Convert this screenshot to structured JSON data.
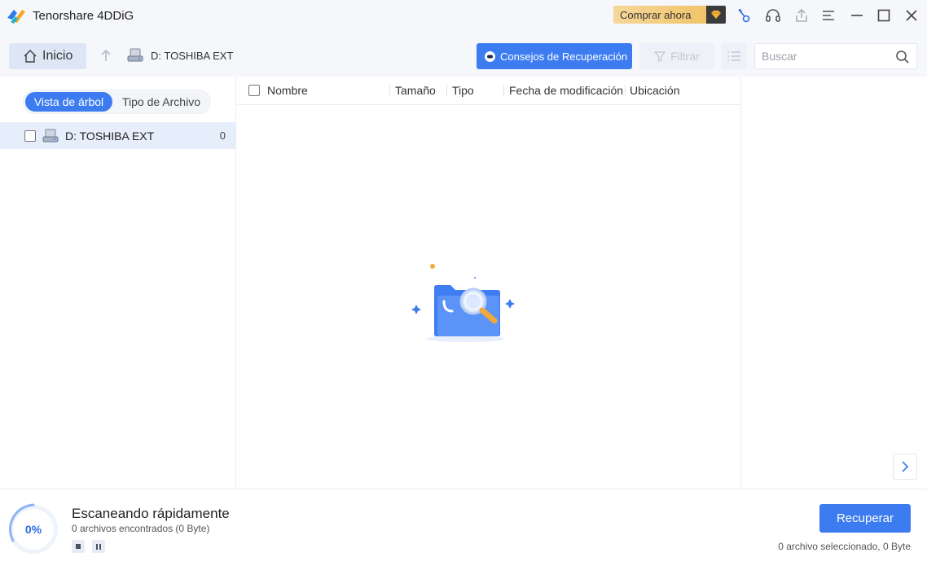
{
  "window": {
    "title": "Tenorshare 4DDiG",
    "buy_label": "Comprar ahora",
    "icons": [
      "key-icon",
      "headset-icon",
      "share-icon",
      "menu-icon",
      "minimize-icon",
      "maximize-icon",
      "close-icon"
    ]
  },
  "toolbar": {
    "home_label": "Inicio",
    "breadcrumb_drive": "D: TOSHIBA EXT",
    "tips_label": "Consejos de Recuperación",
    "filter_label": "Filtrar",
    "search_placeholder": "Buscar"
  },
  "sidebar": {
    "tabs": [
      "Vista de árbol",
      "Tipo de Archivo"
    ],
    "active_tab": "Vista de árbol",
    "tree": [
      {
        "label": "D: TOSHIBA EXT",
        "count": "0"
      }
    ]
  },
  "table": {
    "columns": [
      "Nombre",
      "Tamaño",
      "Tipo",
      "Fecha de modificación",
      "Ubicación"
    ]
  },
  "footer": {
    "progress": "0%",
    "progress_value": 0,
    "scan_title": "Escaneando rápidamente",
    "scan_subtitle": "0 archivos encontrados (0 Byte)",
    "recover_label": "Recuperar",
    "selection_info": "0 archivo seleccionado, 0 Byte"
  },
  "colors": {
    "accent": "#3d7cf0",
    "titlebar_bg": "#f5f7fb",
    "buy_gold": "#f0c060"
  }
}
